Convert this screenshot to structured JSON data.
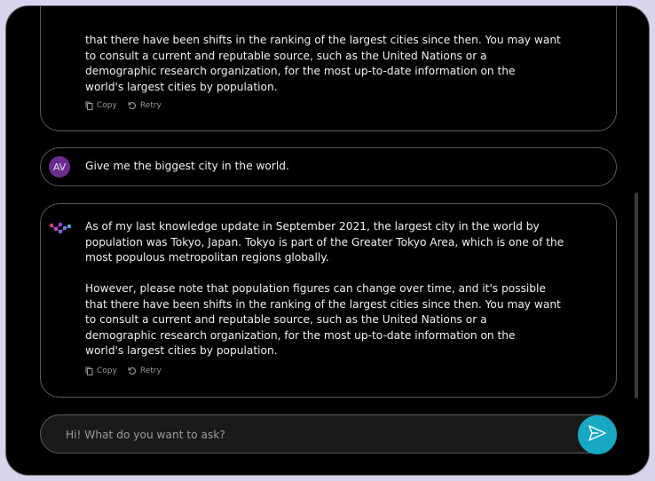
{
  "messages": [
    {
      "role": "assistant",
      "text": "that there have been shifts in the ranking of the largest cities since then. You may want\nto consult a current and reputable source, such as the United Nations or a\ndemographic research organization, for the most up-to-date information on the\nworld's largest cities by population.",
      "copy_label": "Copy",
      "retry_label": "Retry"
    },
    {
      "role": "user",
      "avatar_initials": "AV",
      "text": "Give me the biggest city in the world."
    },
    {
      "role": "assistant",
      "text": "As of my last knowledge update in September 2021, the largest city in the world by\npopulation was Tokyo, Japan. Tokyo is part of the Greater Tokyo Area, which is one of the\nmost populous metropolitan regions globally.\n\nHowever, please note that population figures can change over time, and it's possible\nthat there have been shifts in the ranking of the largest cities since then. You may want\nto consult a current and reputable source, such as the United Nations or a\ndemographic research organization, for the most up-to-date information on the\nworld's largest cities by population.",
      "copy_label": "Copy",
      "retry_label": "Retry"
    }
  ],
  "composer": {
    "placeholder": "Hi! What do you want to ask?",
    "value": ""
  },
  "icons": {
    "copy": "copy-icon",
    "retry": "retry-icon",
    "send": "send-icon",
    "bot_logo": "bot-logo-icon"
  },
  "colors": {
    "accent": "#17a9c4",
    "avatar": "#6a2d8e",
    "background": "#000000"
  }
}
